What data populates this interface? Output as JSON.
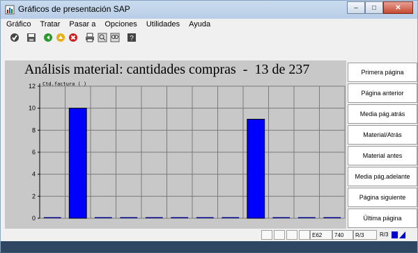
{
  "window": {
    "title": "Gráficos de presentación SAP",
    "minimize": "–",
    "maximize": "□",
    "close": "✕"
  },
  "menu": [
    "Gráfico",
    "Tratar",
    "Pasar a",
    "Opciones",
    "Utilidades",
    "Ayuda"
  ],
  "toolbar": {
    "icons": [
      "check-icon",
      "save-icon",
      "back-icon",
      "exit-icon",
      "cancel-icon",
      "print-icon",
      "find-icon",
      "find-next-icon",
      "help-icon"
    ]
  },
  "chart_data": {
    "type": "bar",
    "title": "Análisis material: cantidades compras  -  13 de 237",
    "unit_label": "Ctd.factura ( )",
    "ylim": [
      0,
      12
    ],
    "yticks": [
      0,
      2,
      4,
      6,
      8,
      10,
      12
    ],
    "categories_count": 12,
    "values": [
      0,
      10,
      0,
      0,
      0,
      0,
      0,
      0,
      9,
      0,
      0,
      0
    ],
    "bar_color": "#0000ff",
    "background": "#c8c8c8",
    "grid": true
  },
  "nav": {
    "buttons": [
      "Primera página",
      "Página anterior",
      "Media pág.atrás",
      "Material/Atrás",
      "Material antes",
      "Media pág.adelante",
      "Página siguiente",
      "Última página"
    ]
  },
  "status": {
    "field1": "E62",
    "field2": "740",
    "field3": "R/3",
    "field4": "R/3"
  },
  "colors": {
    "bar": "#0000ff",
    "chart_bg": "#c8c8c8",
    "grid": "#7a7a7a"
  }
}
